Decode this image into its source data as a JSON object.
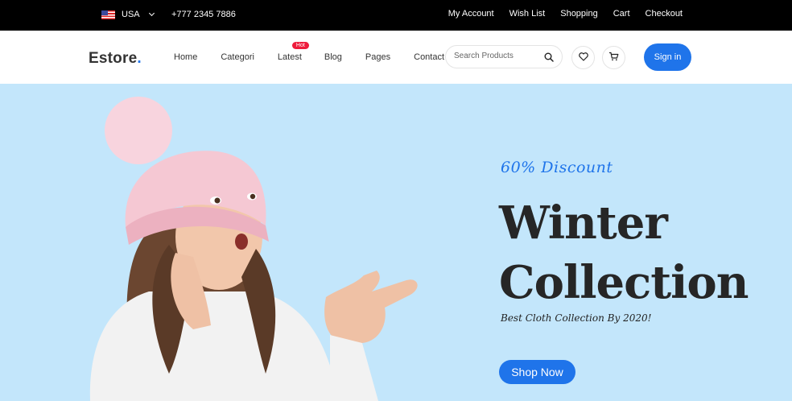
{
  "topbar": {
    "country": "USA",
    "phone": "+777 2345 7886",
    "links": [
      "My Account",
      "Wish List",
      "Shopping",
      "Cart",
      "Checkout"
    ]
  },
  "header": {
    "logo_text": "Estore",
    "logo_dot": ".",
    "nav": [
      "Home",
      "Categori",
      "Latest",
      "Blog",
      "Pages",
      "Contact"
    ],
    "latest_badge": "Hot",
    "search_placeholder": "Search Products",
    "signin_label": "Sign in",
    "icons": [
      "search-icon",
      "heart-icon",
      "cart-icon"
    ]
  },
  "hero": {
    "discount": "60% Discount",
    "title_line1": "Winter",
    "title_line2": "Collection",
    "subtitle": "Best Cloth Collection By 2020!",
    "cta": "Shop Now"
  },
  "colors": {
    "accent": "#1f74ea",
    "hero_bg": "#c3e6fb",
    "badge": "#ee1c3c",
    "topbar": "#000000"
  }
}
